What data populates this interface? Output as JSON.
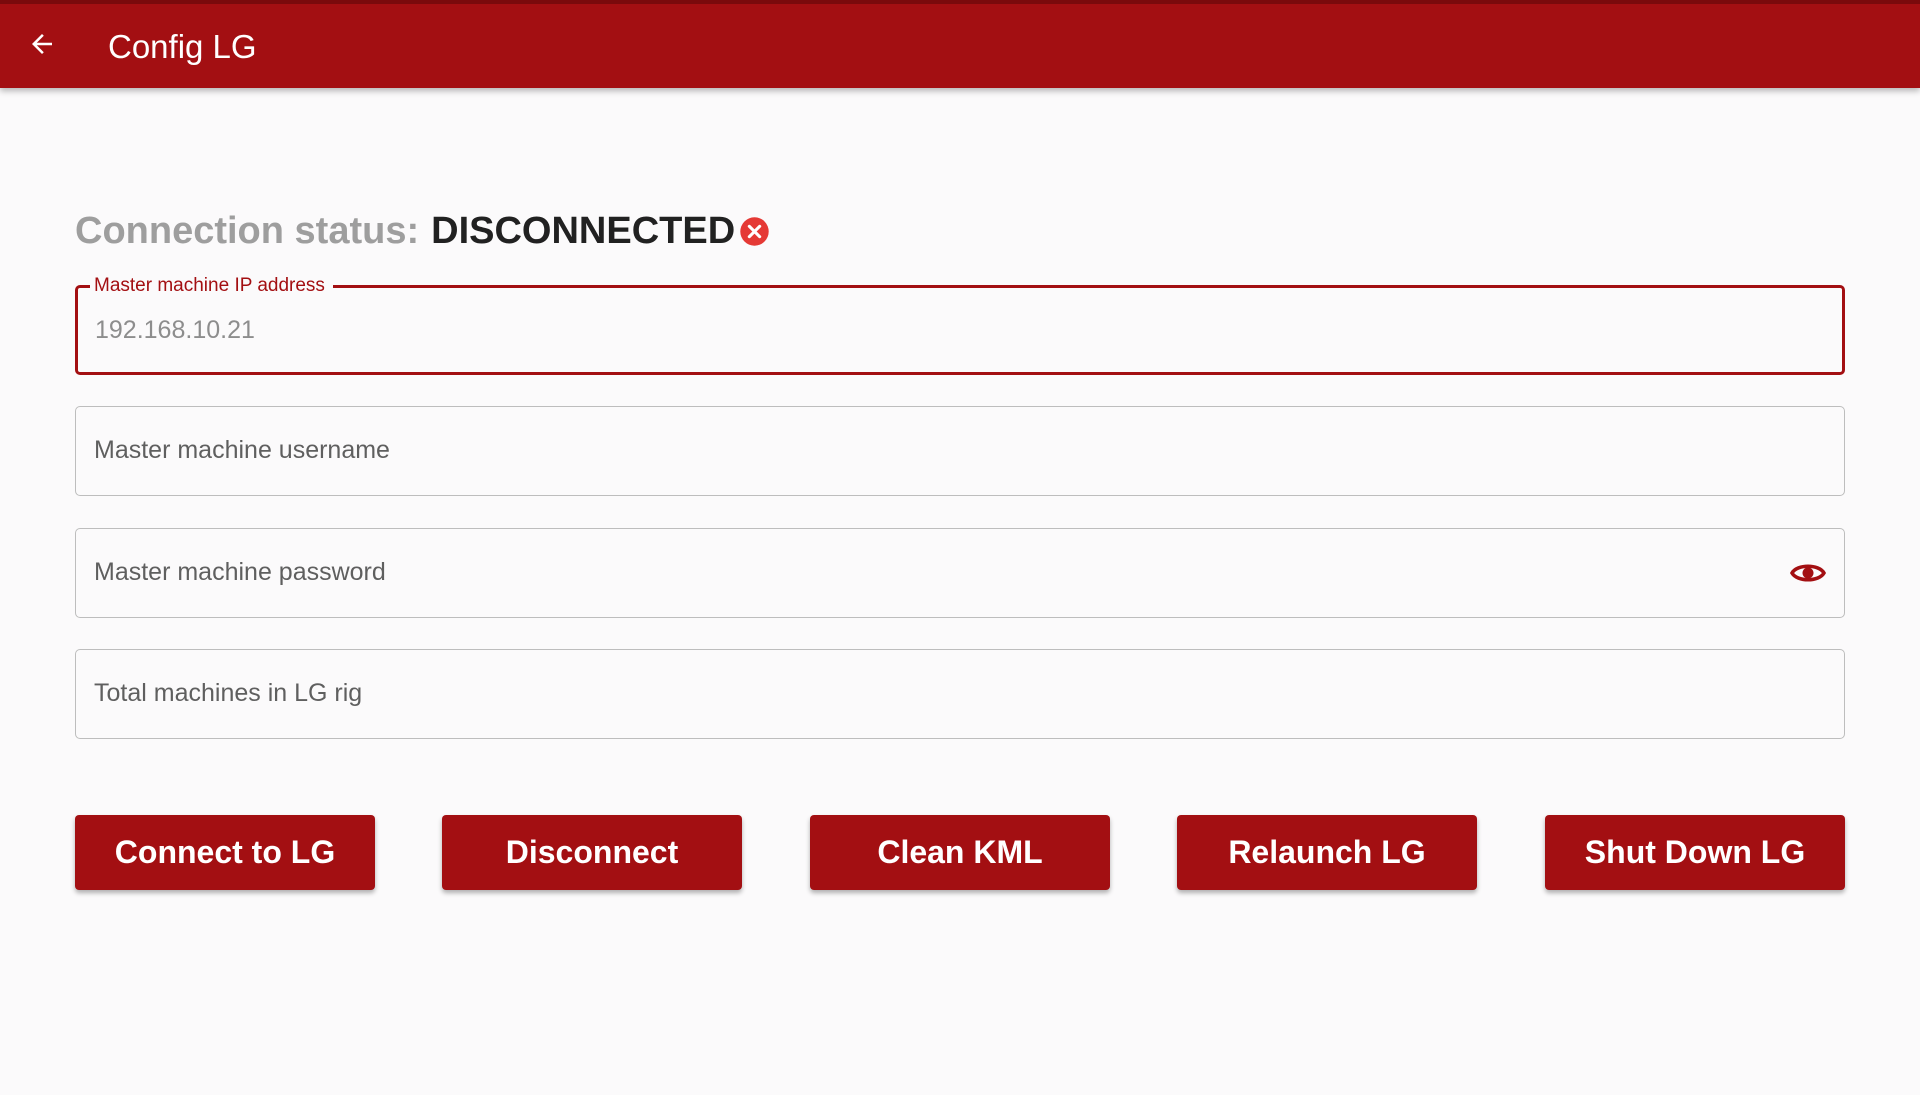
{
  "app_bar": {
    "title": "Config LG",
    "back_icon": "arrow-left-icon",
    "color": "#a30f12"
  },
  "status": {
    "label": "Connection status:",
    "value": "DISCONNECTED",
    "icon": "close-circle-icon",
    "icon_color": "#e53935"
  },
  "form": {
    "ip": {
      "label": "Master machine IP address",
      "value": "192.168.10.21"
    },
    "username": {
      "placeholder": "Master machine username"
    },
    "password": {
      "placeholder": "Master machine password",
      "toggle_icon": "eye-icon"
    },
    "machines": {
      "placeholder": "Total machines in LG rig"
    }
  },
  "actions": {
    "connect": "Connect to LG",
    "disconnect": "Disconnect",
    "clean_kml": "Clean KML",
    "relaunch": "Relaunch LG",
    "shutdown": "Shut Down LG"
  },
  "colors": {
    "primary": "#a30f12",
    "background": "#fbfafb",
    "error": "#e53935"
  }
}
